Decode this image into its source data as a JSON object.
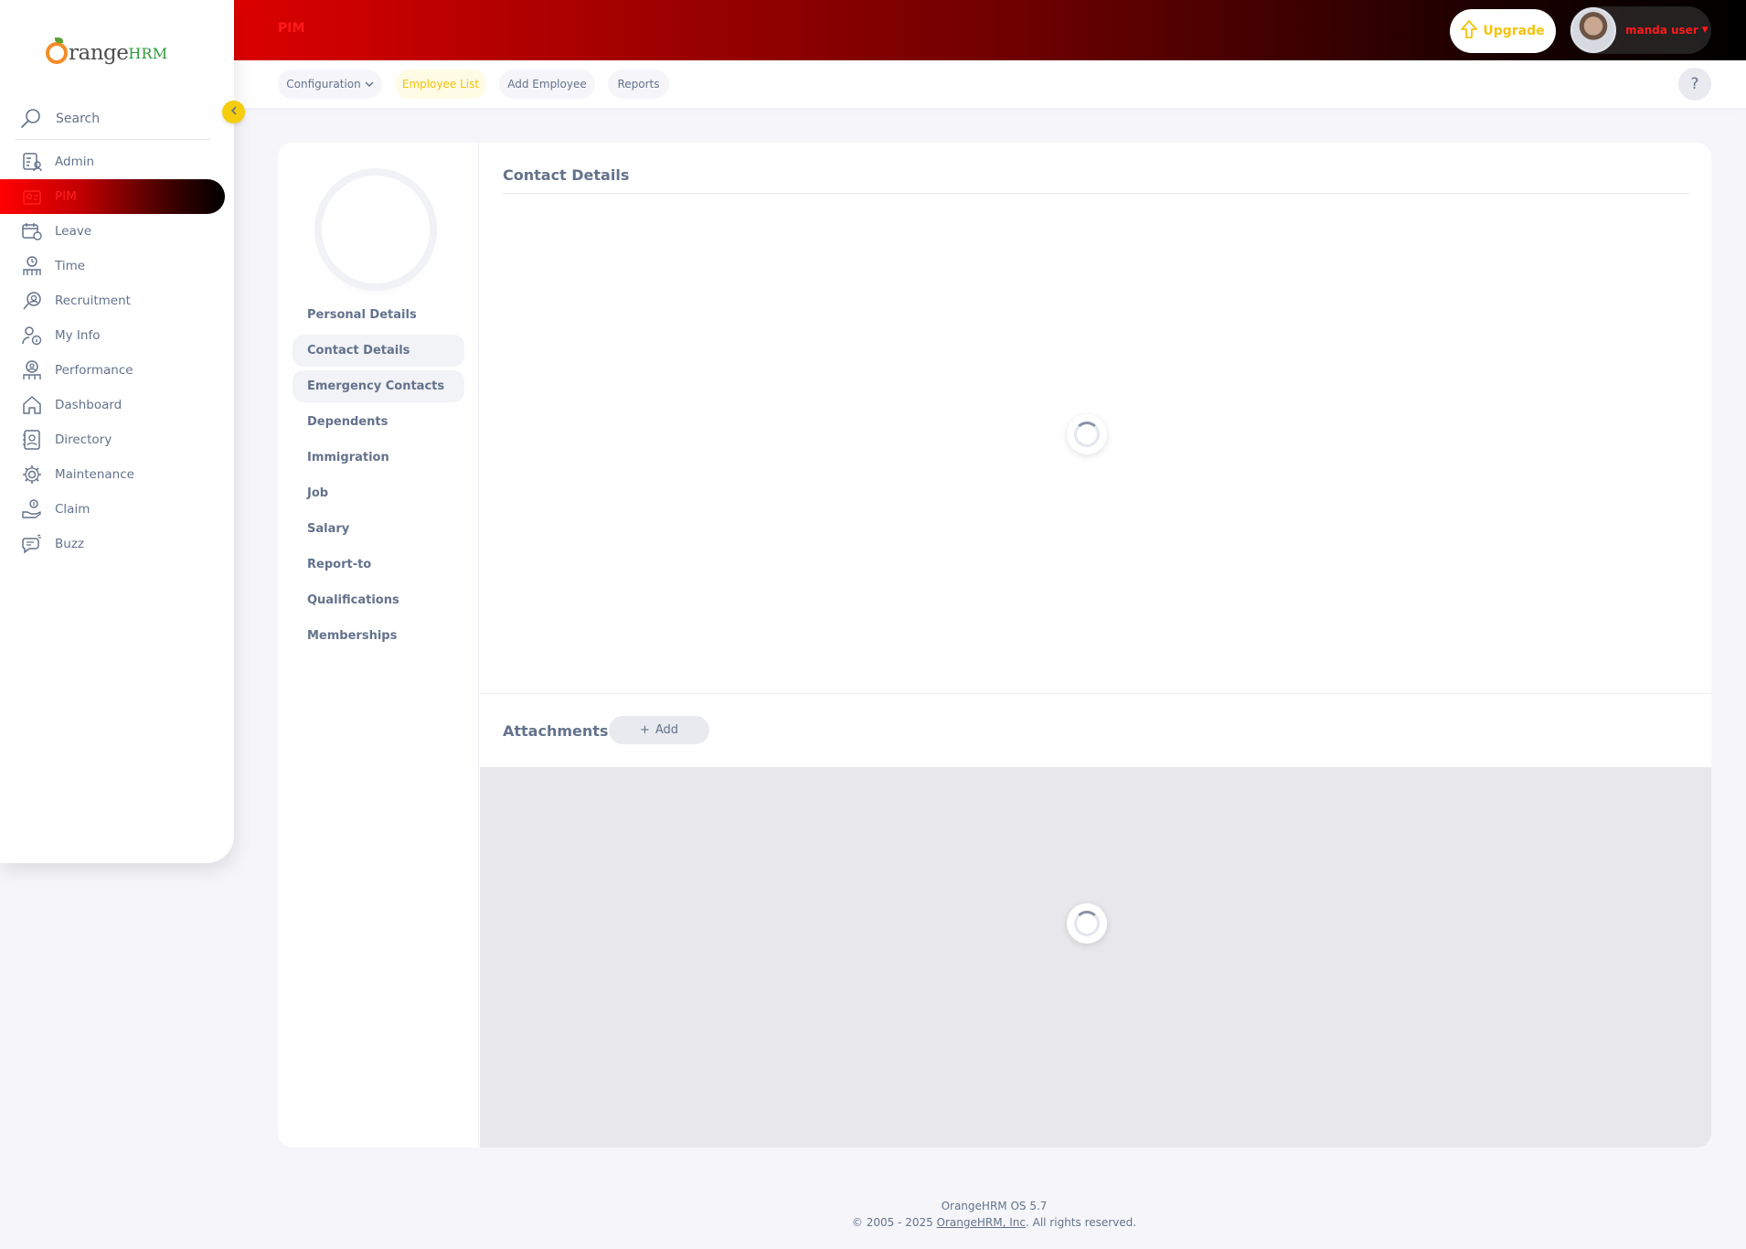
{
  "topbar": {
    "module_title": "PIM",
    "upgrade_label": "Upgrade",
    "user_name": "manda user"
  },
  "sidebar": {
    "search_label": "Search",
    "items": [
      {
        "label": "Admin",
        "icon": "admin-icon"
      },
      {
        "label": "PIM",
        "icon": "pim-icon",
        "active": true
      },
      {
        "label": "Leave",
        "icon": "leave-icon"
      },
      {
        "label": "Time",
        "icon": "time-icon"
      },
      {
        "label": "Recruitment",
        "icon": "recruitment-icon"
      },
      {
        "label": "My Info",
        "icon": "my-info-icon"
      },
      {
        "label": "Performance",
        "icon": "performance-icon"
      },
      {
        "label": "Dashboard",
        "icon": "dashboard-icon"
      },
      {
        "label": "Directory",
        "icon": "directory-icon"
      },
      {
        "label": "Maintenance",
        "icon": "maintenance-icon"
      },
      {
        "label": "Claim",
        "icon": "claim-icon"
      },
      {
        "label": "Buzz",
        "icon": "buzz-icon"
      }
    ]
  },
  "subnav": {
    "configuration": "Configuration",
    "employee_list": "Employee List",
    "add_employee": "Add Employee",
    "reports": "Reports",
    "help": "?"
  },
  "employee_tabs": [
    "Personal Details",
    "Contact Details",
    "Emergency Contacts",
    "Dependents",
    "Immigration",
    "Job",
    "Salary",
    "Report-to",
    "Qualifications",
    "Memberships"
  ],
  "main": {
    "section_title": "Contact Details",
    "attachments_title": "Attachments",
    "add_label": "Add"
  },
  "footer": {
    "version": "OrangeHRM OS 5.7",
    "copyright_prefix": "© 2005 - 2025 ",
    "company_link": "OrangeHRM, Inc",
    "copyright_suffix": ". All rights reserved."
  },
  "colors": {
    "accent": "#ff0000",
    "brand_yellow": "#f5c20c",
    "text": "#64728c"
  }
}
